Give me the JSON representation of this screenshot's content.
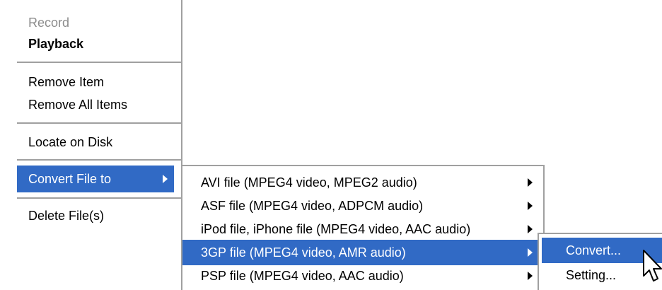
{
  "main_menu": {
    "items": [
      {
        "label": "Record"
      },
      {
        "label": "Playback"
      },
      {
        "label": "Remove Item"
      },
      {
        "label": "Remove All Items"
      },
      {
        "label": "Locate on Disk"
      },
      {
        "label": "Convert File to"
      },
      {
        "label": "Delete File(s)"
      }
    ]
  },
  "convert_submenu": {
    "items": [
      {
        "label": "AVI file (MPEG4 video, MPEG2 audio)"
      },
      {
        "label": "ASF file (MPEG4 video, ADPCM audio)"
      },
      {
        "label": "iPod file, iPhone file (MPEG4 video, AAC audio)"
      },
      {
        "label": "3GP file (MPEG4 video, AMR audio)"
      },
      {
        "label": "PSP file (MPEG4 video, AAC audio)"
      }
    ]
  },
  "format_submenu": {
    "items": [
      {
        "label": "Convert..."
      },
      {
        "label": "Setting..."
      }
    ]
  },
  "icons": {
    "submenu_arrow": "chevron-right-icon",
    "cursor": "arrow-cursor-icon"
  },
  "colors": {
    "highlight": "#316ac5",
    "disabled_text": "#8c8c8c"
  }
}
